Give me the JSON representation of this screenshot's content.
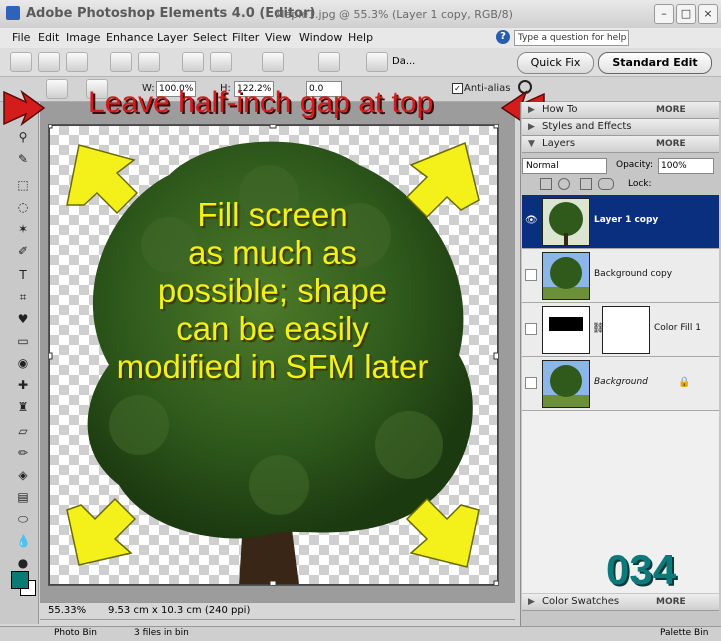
{
  "window": {
    "app_title": "Adobe Photoshop Elements 4.0 (Editor)",
    "doc_title": "Maple1.jpg @ 55.3% (Layer 1 copy, RGB/8)"
  },
  "menu": [
    "File",
    "Edit",
    "Image",
    "Enhance",
    "Layer",
    "Select",
    "Filter",
    "View",
    "Window",
    "Help"
  ],
  "help": {
    "placeholder": "Type a question for help"
  },
  "shortcuts": {
    "date_label": "Da...",
    "quick_fix": "Quick Fix",
    "standard_edit": "Standard Edit"
  },
  "options_bar": {
    "w_label": "W:",
    "w_value": "100.0%",
    "h_label": "H:",
    "h_value": "122.2%",
    "angle_value": "0.0",
    "anti_alias": "Anti-alias"
  },
  "panels": {
    "how_to": "How To",
    "styles_effects": "Styles and Effects",
    "layers": "Layers",
    "more": "MORE",
    "blend_mode": "Normal",
    "opacity_label": "Opacity:",
    "opacity_value": "100%",
    "lock_label": "Lock:",
    "color_swatches": "Color Swatches"
  },
  "layers": [
    {
      "name": "Layer 1 copy",
      "selected": true
    },
    {
      "name": "Background copy",
      "selected": false
    },
    {
      "name": "Color Fill 1",
      "selected": false
    },
    {
      "name": "Background",
      "selected": false
    }
  ],
  "status": {
    "zoom": "55.33%",
    "doc_size": "9.53 cm x 10.3 cm (240 ppi)"
  },
  "photo_bin": {
    "label": "Photo Bin",
    "files": "3 files in bin",
    "palette_bin": "Palette Bin"
  },
  "annotations": {
    "top_note": "Leave half-inch gap at top",
    "center_lines": [
      "Fill screen",
      "as much as",
      "possible; shape",
      "can be easily",
      "modified in SFM later"
    ],
    "step_number": "034"
  },
  "colors": {
    "annotation_red": "#d41c1c",
    "annotation_yellow": "#f3f01a",
    "step_teal": "#0c7a7a",
    "selection_blue": "#0b2f7f",
    "foreground_color": "#0a7a74"
  }
}
